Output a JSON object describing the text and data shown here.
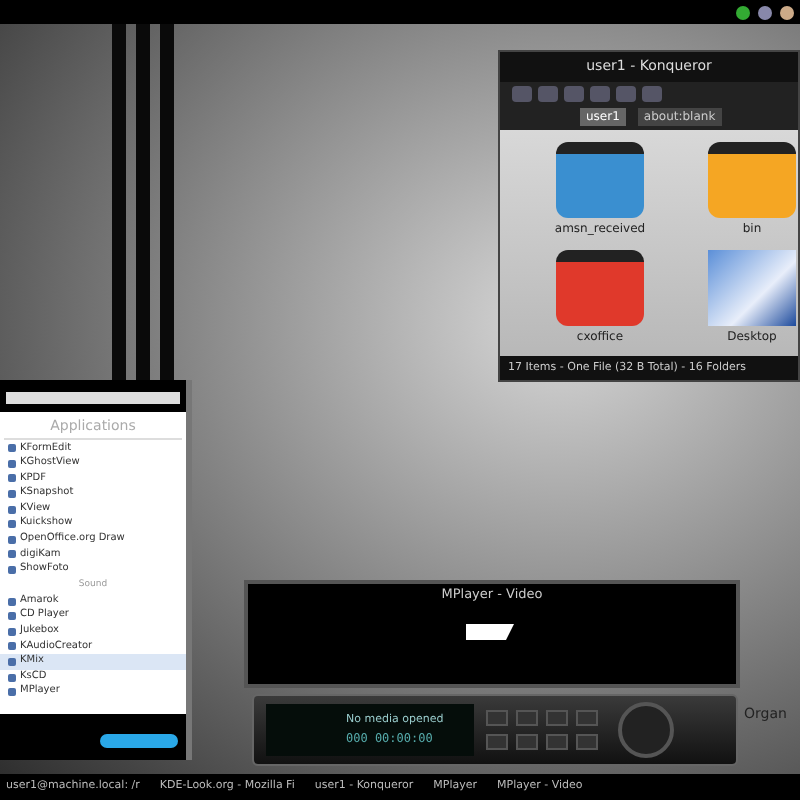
{
  "konqueror": {
    "title": "user1 - Konqueror",
    "tabs": [
      {
        "label": "user1",
        "selected": true
      },
      {
        "label": "about:blank",
        "selected": false
      }
    ],
    "items": [
      {
        "name": "amsn_received",
        "kind": "folder",
        "color": "#3a8fd0"
      },
      {
        "name": "bin",
        "kind": "folder",
        "color": "#f5a623"
      },
      {
        "name": "cxoffice",
        "kind": "folder",
        "color": "#e0392b"
      },
      {
        "name": "Desktop",
        "kind": "preview"
      }
    ],
    "status": "17 Items - One File (32 B Total) - 16 Folders"
  },
  "menu": {
    "header": "Applications",
    "items": [
      {
        "kind": "item",
        "label": "KFormEdit",
        "selected": false
      },
      {
        "kind": "item",
        "label": "KGhostView",
        "selected": false
      },
      {
        "kind": "item",
        "label": "KPDF",
        "selected": false
      },
      {
        "kind": "item",
        "label": "KSnapshot",
        "selected": false
      },
      {
        "kind": "item",
        "label": "KView",
        "selected": false
      },
      {
        "kind": "item",
        "label": "Kuickshow",
        "selected": false
      },
      {
        "kind": "item",
        "label": "OpenOffice.org Draw",
        "selected": false
      },
      {
        "kind": "item",
        "label": "digiKam",
        "selected": false
      },
      {
        "kind": "item",
        "label": "ShowFoto",
        "selected": false
      },
      {
        "kind": "section",
        "label": "Sound"
      },
      {
        "kind": "item",
        "label": "Amarok",
        "selected": false
      },
      {
        "kind": "item",
        "label": "CD Player",
        "selected": false
      },
      {
        "kind": "item",
        "label": "Jukebox",
        "selected": false
      },
      {
        "kind": "item",
        "label": "KAudioCreator",
        "selected": false
      },
      {
        "kind": "item",
        "label": "KMix",
        "selected": true
      },
      {
        "kind": "item",
        "label": "KsCD",
        "selected": false
      },
      {
        "kind": "item",
        "label": "MPlayer",
        "selected": false
      }
    ]
  },
  "mplayer": {
    "title": "MPlayer - Video",
    "display": "No media opened",
    "time": "000 00:00:00"
  },
  "wallpaper_text": "Organ",
  "taskbar": [
    {
      "label": "user1@machine.local: /r",
      "selected": false
    },
    {
      "label": "KDE-Look.org - Mozilla Fi",
      "selected": false
    },
    {
      "label": "user1 - Konqueror",
      "selected": false
    },
    {
      "label": "MPlayer",
      "selected": false
    },
    {
      "label": "MPlayer - Video",
      "selected": false
    }
  ]
}
